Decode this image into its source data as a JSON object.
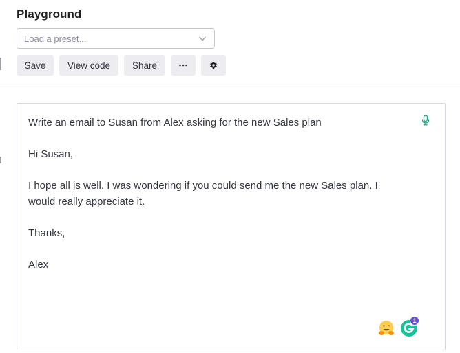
{
  "header": {
    "title": "Playground"
  },
  "preset": {
    "placeholder": "Load a preset...",
    "icon": "chevron-down-icon"
  },
  "toolbar": {
    "save_label": "Save",
    "view_code_label": "View code",
    "share_label": "Share",
    "more_label": "···",
    "settings_icon": "gear-icon"
  },
  "editor": {
    "lines": [
      "Write an email to Susan from Alex asking for the new Sales plan",
      "Hi Susan,",
      "I hope all is well. I was wondering if you could send me the new Sales plan. I",
      "would really appreciate it.",
      "Thanks,",
      "Alex"
    ],
    "mic_icon": "microphone-icon",
    "extensions": {
      "emoji_icon": "hugging-face-emoji-icon",
      "grammarly_icon": "grammarly-icon",
      "grammarly_badge": "1"
    }
  },
  "colors": {
    "accent_green": "#10a37f",
    "button_bg": "#ececf1",
    "text": "#353740",
    "grammarly_green": "#15c39a",
    "badge_purple": "#6b4fd8"
  }
}
